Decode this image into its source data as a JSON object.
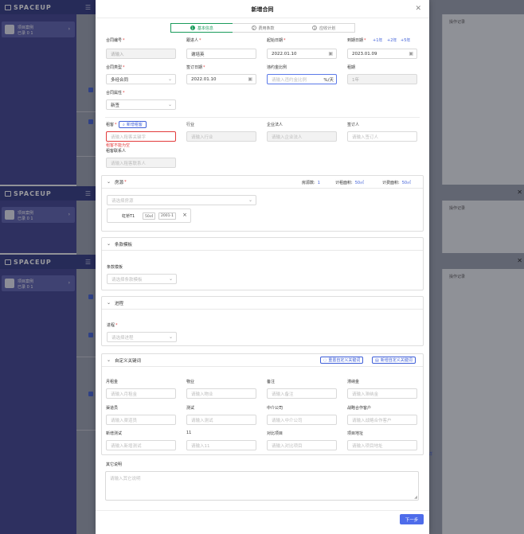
{
  "background": {
    "brand": "SPACEUP",
    "side_item_title": "项目案例",
    "side_item_sub": "已录 0 1",
    "right_panel_title": "操作记录",
    "blue_link": "详"
  },
  "modal": {
    "title": "新增合同",
    "steps": [
      {
        "num": "1",
        "label": "基本信息"
      },
      {
        "num": "2",
        "label": "费用条款"
      },
      {
        "num": "3",
        "label": "应收计划"
      }
    ],
    "fields": {
      "contract_no": {
        "label": "合同编号",
        "placeholder": "请输入"
      },
      "signer": {
        "label": "跟进人",
        "value": "谢培英"
      },
      "start_date": {
        "label": "起始日期",
        "value": "2022.01.10"
      },
      "end_date": {
        "label": "到期日期",
        "value": "2023.01.09",
        "quick": [
          "+1年",
          "+2年",
          "+5年"
        ]
      },
      "contract_type": {
        "label": "合同类型",
        "value": "多经合同"
      },
      "sign_date": {
        "label": "签订日期",
        "value": "2022.01.10"
      },
      "penalty_ratio": {
        "label": "违约金比例",
        "placeholder": "请输入违约金比例",
        "suffix": "%/天"
      },
      "lease_term": {
        "label": "租期",
        "value": "1年"
      },
      "contract_attr": {
        "label": "合同属性",
        "value": "新签"
      },
      "tenant": {
        "label": "租客",
        "placeholder": "请输入租客关键字",
        "error": "租客不能为空",
        "add_btn": "新增租客"
      },
      "industry": {
        "label": "行业",
        "placeholder": "请输入行业"
      },
      "legal_person": {
        "label": "企业法人",
        "placeholder": "请输入企业法人"
      },
      "signatory": {
        "label": "签订人",
        "placeholder": "请输入签订人"
      },
      "tenant_contact": {
        "label": "租客联系人",
        "placeholder": "请输入租客联系人"
      }
    },
    "house": {
      "title": "房源",
      "count_label": "房源数:",
      "count": "1",
      "calc_area_label": "计租面积:",
      "calc_area": "50㎡",
      "charge_area_label": "计费面积:",
      "charge_area": "50㎡",
      "select_placeholder": "请选择房源",
      "item_name": "虹桥T1",
      "item_area": "50㎡",
      "item_room": "2001-1"
    },
    "clause": {
      "title": "条款模板",
      "field_label": "条款模板",
      "placeholder": "请选择条款模板"
    },
    "progress": {
      "title": "进程",
      "field_label": "进程",
      "placeholder": "请选择进程"
    },
    "custom": {
      "title": "自定义关键词",
      "reset_btn": "重置自定义关键词",
      "add_btn": "新增自定义关键词",
      "fields": [
        {
          "label": "月租金",
          "placeholder": "请输入月租金"
        },
        {
          "label": "物业",
          "placeholder": "请输入物业"
        },
        {
          "label": "备注",
          "placeholder": "请输入备注"
        },
        {
          "label": "滞纳金",
          "placeholder": "请输入滞纳金"
        },
        {
          "label": "渠道员",
          "placeholder": "请输入渠道员"
        },
        {
          "label": "测试",
          "placeholder": "请输入测试"
        },
        {
          "label": "中介公司",
          "placeholder": "请输入中介公司"
        },
        {
          "label": "战略合作客户",
          "placeholder": "请输入战略合作客户"
        },
        {
          "label": "新增测试",
          "placeholder": "请输入新增测试"
        },
        {
          "label": "11",
          "placeholder": "请输入11"
        },
        {
          "label": "对比项目",
          "placeholder": "请输入对比项目"
        },
        {
          "label": "项目地址",
          "placeholder": "请输入项目地址"
        }
      ]
    },
    "other": {
      "label": "其它说明",
      "placeholder": "请输入其它说明"
    },
    "next_btn": "下一步"
  }
}
